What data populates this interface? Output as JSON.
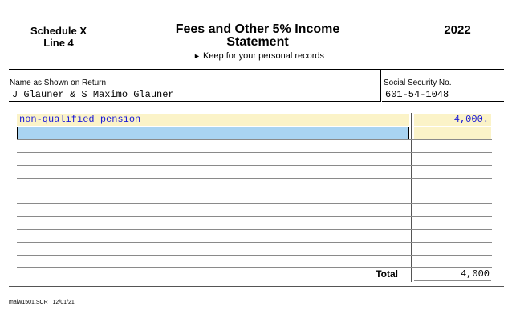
{
  "header": {
    "schedule_line1": "Schedule X",
    "schedule_line2": "Line 4",
    "title_line1": "Fees and Other 5% Income",
    "title_line2": "Statement",
    "keep_note": "Keep for your personal records",
    "year": "2022"
  },
  "taxpayer": {
    "name_label": "Name as Shown on Return",
    "name_value": "J Glauner & S Maximo Glauner",
    "ssn_label": "Social Security No.",
    "ssn_value": "601-54-1048"
  },
  "rows": [
    {
      "description": "non-qualified pension",
      "amount": "4,000."
    },
    {
      "description": "",
      "amount": ""
    }
  ],
  "total": {
    "label": "Total",
    "value": "4,000"
  },
  "footer": {
    "form_id": "maiw1501.SCR",
    "date": "12/01/21"
  }
}
